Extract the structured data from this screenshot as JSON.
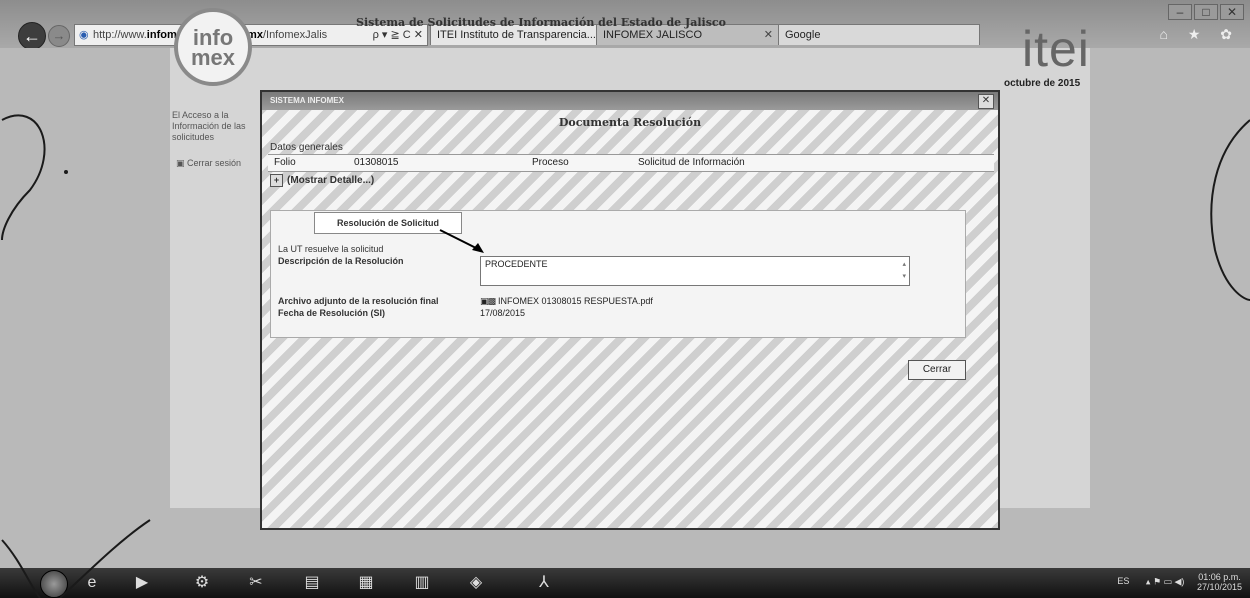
{
  "browser": {
    "url_prefix": "http://www.",
    "url_host": "infomexjalisco.org.mx",
    "url_path": "/InfomexJalis",
    "address_controls": "ρ ▾ ≧ C ✕",
    "tabs": [
      {
        "label": "ITEI Instituto de Transparencia..."
      },
      {
        "label": "INFOMEX JALISCO"
      },
      {
        "label": "Google"
      }
    ],
    "window_controls": [
      "–",
      "□",
      "✕"
    ],
    "tool_icons": "⌂ ★ ✿"
  },
  "page": {
    "site_title": "Sistema de Solicitudes de Información del Estado de Jalisco",
    "logo_left_top": "info",
    "logo_left_bottom": "mex",
    "logo_right": "itei",
    "date_text": "octubre de 2015",
    "side_link_1": "El Acceso a la Información de las solicitudes",
    "side_link_2": "Cerrar sesión"
  },
  "modal": {
    "title_bar": "SISTEMA INFOMEX",
    "close_glyph": "✕",
    "document_title": "Documenta Resolución",
    "general_heading": "Datos generales",
    "folio_label": "Folio",
    "folio_value": "01308015",
    "proceso_label": "Proceso",
    "proceso_value": "Solicitud de Información",
    "details_toggle": "(Mostrar Detalle...)",
    "resolution_tab": "Resolución de Solicitud",
    "ut_text": "La UT resuelve la solicitud",
    "description_label": "Descripción de la Resolución",
    "description_value": "PROCEDENTE",
    "attachments_label": "Archivo adjunto de la resolución final",
    "attachment_file": "INFOMEX 01308015 RESPUESTA.pdf",
    "date_label": "Fecha de Resolución (SI)",
    "date_value": "17/08/2015",
    "close_button": "Cerrar"
  },
  "taskbar": {
    "language": "ES",
    "time": "01:06 p.m.",
    "date": "27/10/2015"
  }
}
